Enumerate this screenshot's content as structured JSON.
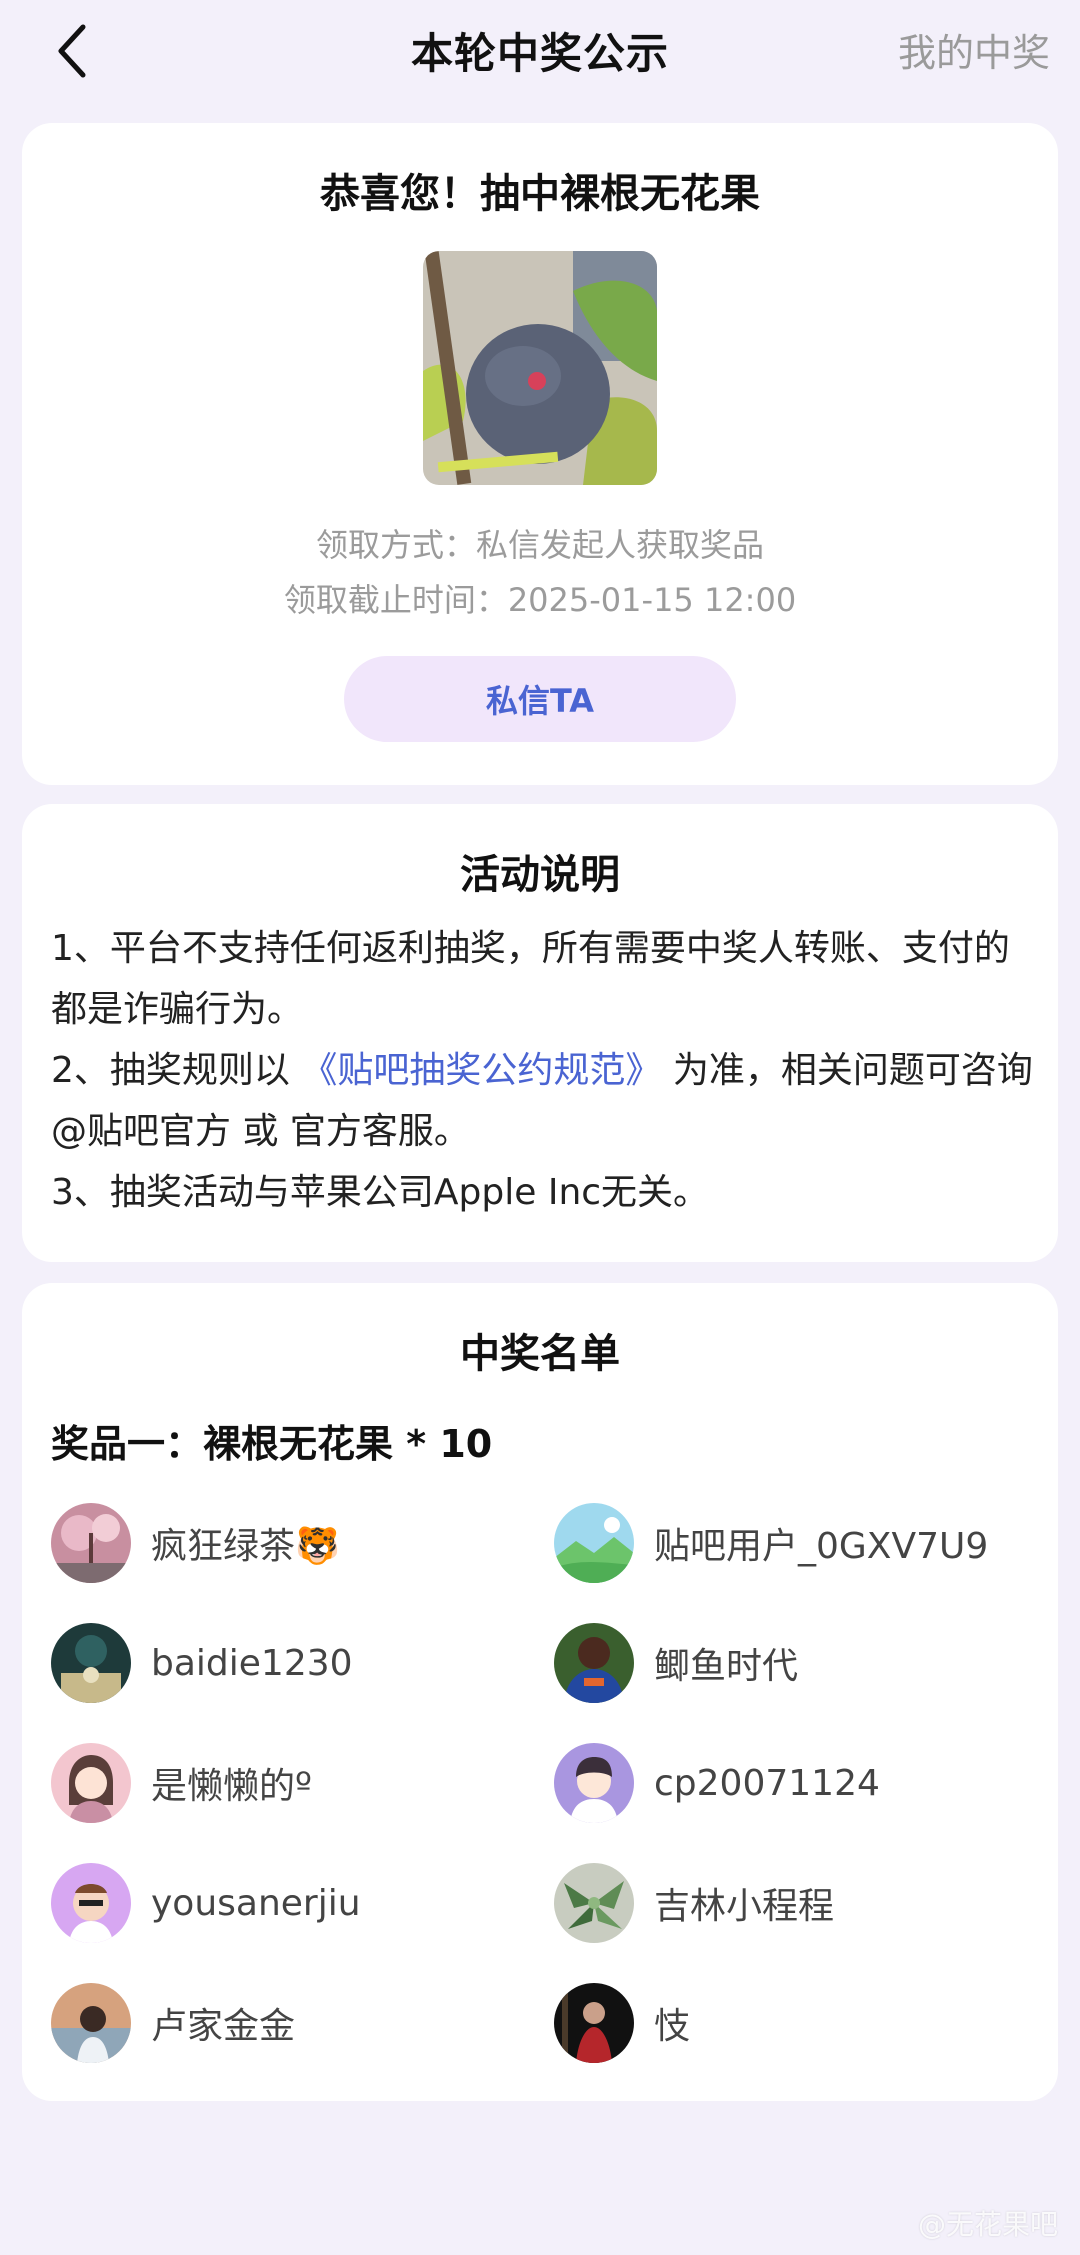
{
  "nav": {
    "title": "本轮中奖公示",
    "my_prizes": "我的中奖",
    "back_icon": "chevron-left-icon"
  },
  "result": {
    "congrats": "恭喜您！抽中裸根无花果",
    "claim_method": "领取方式：私信发起人获取奖品",
    "deadline": "领取截止时间：2025-01-15 12:00",
    "message_button": "私信TA"
  },
  "rules": {
    "title": "活动说明",
    "line1": "1、平台不支持任何返利抽奖，所有需要中奖人转账、支付的都是诈骗行为。",
    "line2_prefix": "2、抽奖规则以",
    "line2_link": "《贴吧抽奖公约规范》",
    "line2_suffix": "为准，相关问题可咨询@贴吧官方 或 官方客服。",
    "line3": "3、抽奖活动与苹果公司Apple Inc无关。"
  },
  "winners": {
    "title": "中奖名单",
    "prize_line": "奖品一：裸根无花果 * 10",
    "list": [
      {
        "name": "疯狂绿茶🐯"
      },
      {
        "name": "贴吧用户_0GXV7U9"
      },
      {
        "name": "baidie1230"
      },
      {
        "name": "鲫鱼时代"
      },
      {
        "name": "是懒懒的º"
      },
      {
        "name": "cp20071124"
      },
      {
        "name": "yousanerjiu"
      },
      {
        "name": "吉林小程程"
      },
      {
        "name": "卢家金金"
      },
      {
        "name": "忮"
      }
    ]
  },
  "colors": {
    "background": "#f3f0fa",
    "link": "#4a64d2",
    "button_bg": "#f1e6fb"
  },
  "watermark": "@无花果吧"
}
